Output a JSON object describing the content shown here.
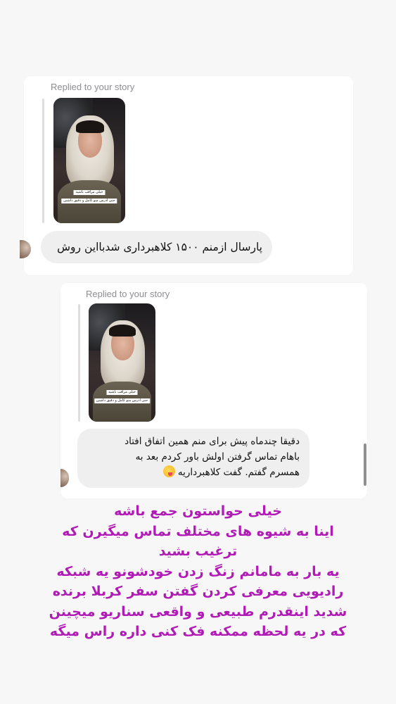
{
  "messages": [
    {
      "replied_label": "Replied to your story",
      "story_caption": {
        "line1": "خیلی مراقب باشید",
        "line2": "حتی ادرس منو کامل و دقیق داشتن"
      },
      "text": "پارسال ازمنم ۱۵۰۰ کلاهبرداری شدبااین روش"
    },
    {
      "replied_label": "Replied to your story",
      "story_caption": {
        "line1": "خیلی مراقب باشید",
        "line2": "حتی ادرس منو کامل و دقیق داشتن"
      },
      "text_lines": [
        "دقیقا چندماه پیش برای منم همین اتفاق افتاد",
        "باهام تماس گرفتن اولش باور کردم بعد به",
        "همسرم گفتم. گفت کلاهبرداریه"
      ],
      "emoji": "wink-tongue-emoji"
    }
  ],
  "overlay_note": {
    "color": "#b01ab5",
    "lines": [
      "خیلی حواستون جمع باشه",
      "اینا به شیوه های مختلف تماس میگیرن که",
      "ترغیب بشید",
      "یه بار به مامانم زنگ زدن خودشونو یه شبکه",
      "رادیویی معرفی کردن گفتن سفر کربلا برنده",
      "شدید اینقدرم طبیعی و واقعی سناریو میچینن",
      "که در یه لحظه ممکنه فک کنی داره راس میگه"
    ]
  }
}
